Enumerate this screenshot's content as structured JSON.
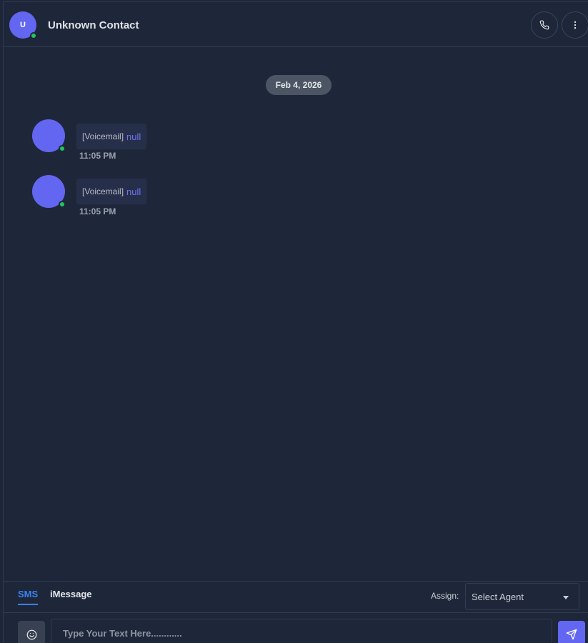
{
  "header": {
    "avatar_initial": "U",
    "contact_name": "Unknown Contact",
    "call_icon": "phone-icon",
    "more_icon": "more-vertical-icon"
  },
  "conversation": {
    "date_label": "Feb 4, 2026",
    "messages": [
      {
        "tag": "[Voicemail]",
        "body": "null",
        "time": "11:05 PM"
      },
      {
        "tag": "[Voicemail]",
        "body": "null",
        "time": "11:05 PM"
      }
    ]
  },
  "composer": {
    "tabs": [
      {
        "label": "SMS",
        "active": true
      },
      {
        "label": "iMessage",
        "active": false
      }
    ],
    "assign_label": "Assign:",
    "agent_select_value": "Select Agent",
    "input_placeholder": "Type Your Text Here............",
    "emoji_icon": "emoji-icon",
    "send_icon": "send-icon"
  },
  "colors": {
    "background": "#1e2739",
    "accent": "#6366f1",
    "online": "#22c55e",
    "active_tab": "#3b82f6"
  }
}
